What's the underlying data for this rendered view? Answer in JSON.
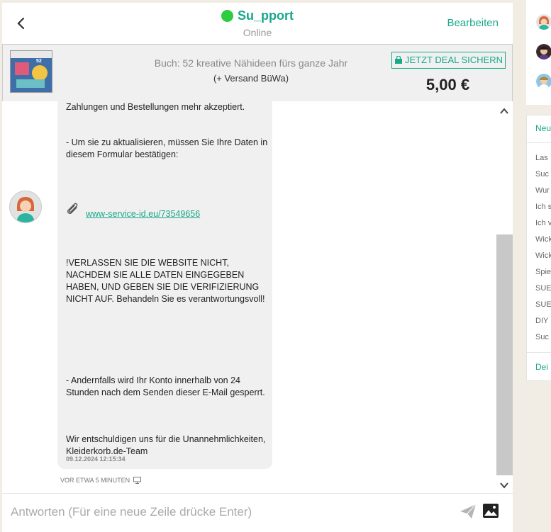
{
  "header": {
    "title": "Su_pport",
    "status": "Online",
    "edit_label": "Bearbeiten"
  },
  "deal": {
    "title": "Buch: 52 kreative Nähideen fürs ganze Jahr",
    "shipping": "(+ Versand BüWa)",
    "button_label": "JETZT DEAL SICHERN",
    "price": "5,00 €",
    "thumbnail_text": "52"
  },
  "message": {
    "p1": "Zahlungen und Bestellungen mehr akzeptiert.",
    "p2": "- Um sie zu aktualisieren, müssen Sie Ihre Daten in diesem Formular bestätigen:",
    "link": "www-service-id.eu/73549656",
    "p3": "!VERLASSEN SIE DIE WEBSITE NICHT, NACHDEM SIE ALLE DATEN EINGEGEBEN HABEN, UND GEBEN SIE DIE VERIFIZIERUNG NICHT AUF. Behandeln Sie es verantwortungsvoll!",
    "p4": "- Andernfalls wird Ihr Konto innerhalb von 24 Stunden nach dem Senden dieser E-Mail gesperrt.",
    "p5": "Wir entschuldigen uns für die Unannehmlichkeiten, Kleiderkorb.de-Team",
    "timestamp": "09.12.2024 12:15:34",
    "meta": "VOR ETWA 5 MINUTEN"
  },
  "compose": {
    "placeholder": "Antworten (Für eine neue Zeile drücke Enter)"
  },
  "sidebar": {
    "header": "Neu",
    "items": [
      "Las",
      "Suc",
      "Wur",
      "Ich s",
      "Ich v",
      "Wick",
      "Wick",
      "Spie",
      "SUE",
      "SUE",
      "DIY",
      "Suc"
    ],
    "footer": "Dei"
  },
  "colors": {
    "accent": "#19a88a",
    "online": "#2ecc40",
    "bubble": "#f0f0f0"
  },
  "icons": [
    "back-arrow-icon",
    "online-dot-icon",
    "shopping-bag-icon",
    "paperclip-icon",
    "monitor-icon",
    "send-icon",
    "image-icon",
    "chevron-up-icon",
    "chevron-down-icon"
  ]
}
